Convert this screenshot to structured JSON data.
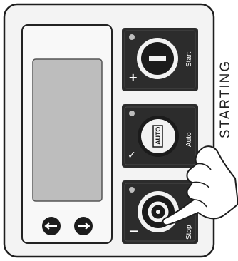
{
  "status_label": "STARTING",
  "buttons": {
    "start": {
      "label": "Start",
      "sign": "+"
    },
    "auto": {
      "label": "Auto",
      "badge": "AUTO",
      "sign": "✓"
    },
    "stop": {
      "label": "Stop",
      "sign": "−"
    }
  },
  "nav": {
    "left_icon": "arrow-left-icon",
    "right_icon": "arrow-right-icon"
  },
  "colors": {
    "panel": "#f2f2f2",
    "button_face": "#2a2a2a",
    "display": "#bdbdbd"
  }
}
